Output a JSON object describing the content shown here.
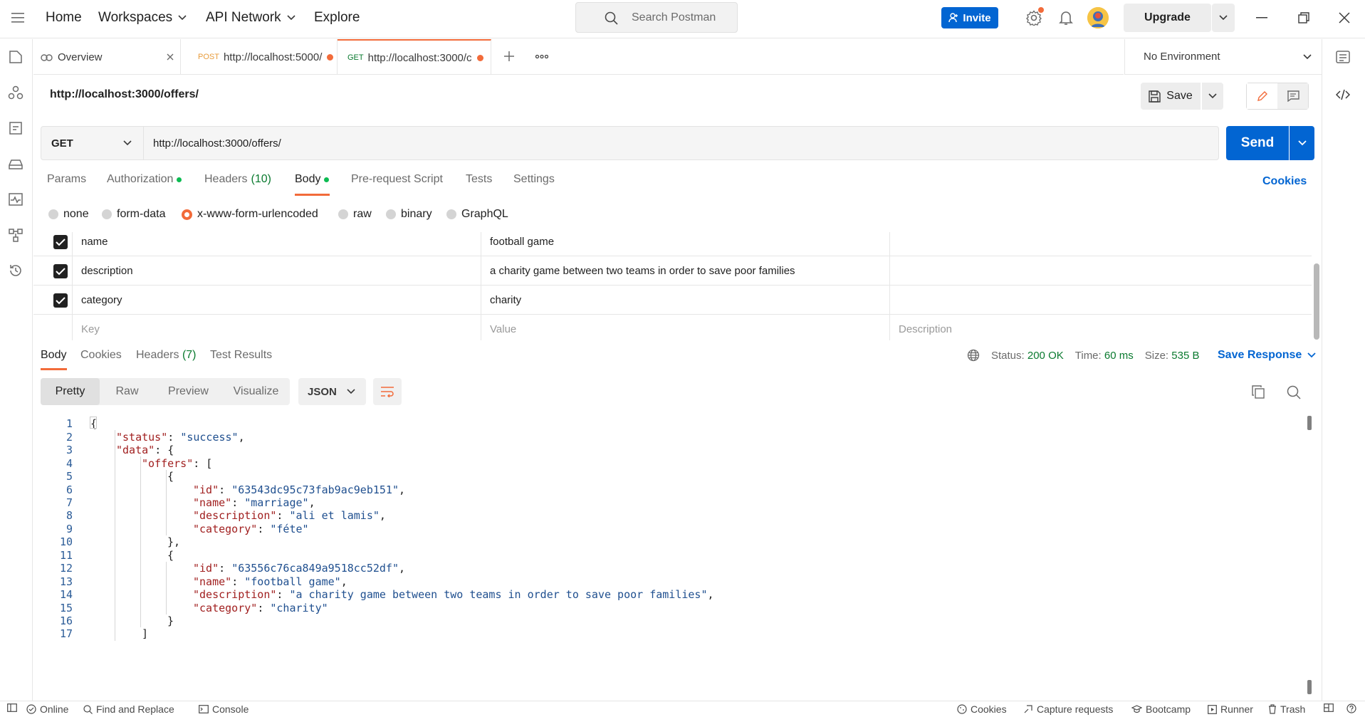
{
  "topbar": {
    "nav": [
      "Home",
      "Workspaces",
      "API Network",
      "Explore"
    ],
    "search_placeholder": "Search Postman",
    "invite_label": "Invite",
    "upgrade_label": "Upgrade"
  },
  "tabs": [
    {
      "label": "Overview",
      "method": ""
    },
    {
      "label": "http://localhost:5000/",
      "method": "POST"
    },
    {
      "label": "http://localhost:3000/c",
      "method": "GET"
    }
  ],
  "environment": "No Environment",
  "request": {
    "title": "http://localhost:3000/offers/",
    "save_label": "Save",
    "method": "GET",
    "url": "http://localhost:3000/offers/",
    "send_label": "Send"
  },
  "request_tabs": {
    "params": "Params",
    "authorization": "Authorization",
    "headers": "Headers",
    "headers_count": "(10)",
    "body": "Body",
    "prerequest": "Pre-request Script",
    "tests": "Tests",
    "settings": "Settings",
    "cookies": "Cookies"
  },
  "body_types": [
    "none",
    "form-data",
    "x-www-form-urlencoded",
    "raw",
    "binary",
    "GraphQL"
  ],
  "kv_rows": [
    {
      "key": "name",
      "value": "football game"
    },
    {
      "key": "description",
      "value": "a charity game between two teams in order to save poor families"
    },
    {
      "key": "category",
      "value": "charity"
    }
  ],
  "kv_placeholders": {
    "key": "Key",
    "value": "Value",
    "description": "Description"
  },
  "response": {
    "tabs": {
      "body": "Body",
      "cookies": "Cookies",
      "headers": "Headers",
      "headers_count": "(7)",
      "tests": "Test Results"
    },
    "status_label": "Status:",
    "status_value": "200 OK",
    "time_label": "Time:",
    "time_value": "60 ms",
    "size_label": "Size:",
    "size_value": "535 B",
    "save_response": "Save Response",
    "views": [
      "Pretty",
      "Raw",
      "Preview",
      "Visualize"
    ],
    "format": "JSON"
  },
  "code_lines": [
    {
      "n": "1",
      "indent": 0,
      "parts": [
        [
          "p",
          "{"
        ]
      ]
    },
    {
      "n": "2",
      "indent": 1,
      "parts": [
        [
          "k",
          "\"status\""
        ],
        [
          "p",
          ": "
        ],
        [
          "s",
          "\"success\""
        ],
        [
          "p",
          ","
        ]
      ]
    },
    {
      "n": "3",
      "indent": 1,
      "parts": [
        [
          "k",
          "\"data\""
        ],
        [
          "p",
          ": {"
        ]
      ]
    },
    {
      "n": "4",
      "indent": 2,
      "parts": [
        [
          "k",
          "\"offers\""
        ],
        [
          "p",
          ": ["
        ]
      ]
    },
    {
      "n": "5",
      "indent": 3,
      "parts": [
        [
          "p",
          "{"
        ]
      ]
    },
    {
      "n": "6",
      "indent": 4,
      "parts": [
        [
          "k",
          "\"id\""
        ],
        [
          "p",
          ": "
        ],
        [
          "s",
          "\"63543dc95c73fab9ac9eb151\""
        ],
        [
          "p",
          ","
        ]
      ]
    },
    {
      "n": "7",
      "indent": 4,
      "parts": [
        [
          "k",
          "\"name\""
        ],
        [
          "p",
          ": "
        ],
        [
          "s",
          "\"marriage\""
        ],
        [
          "p",
          ","
        ]
      ]
    },
    {
      "n": "8",
      "indent": 4,
      "parts": [
        [
          "k",
          "\"description\""
        ],
        [
          "p",
          ": "
        ],
        [
          "s",
          "\"ali et lamis\""
        ],
        [
          "p",
          ","
        ]
      ]
    },
    {
      "n": "9",
      "indent": 4,
      "parts": [
        [
          "k",
          "\"category\""
        ],
        [
          "p",
          ": "
        ],
        [
          "s",
          "\"féte\""
        ]
      ]
    },
    {
      "n": "10",
      "indent": 3,
      "parts": [
        [
          "p",
          "},"
        ]
      ]
    },
    {
      "n": "11",
      "indent": 3,
      "parts": [
        [
          "p",
          "{"
        ]
      ]
    },
    {
      "n": "12",
      "indent": 4,
      "parts": [
        [
          "k",
          "\"id\""
        ],
        [
          "p",
          ": "
        ],
        [
          "s",
          "\"63556c76ca849a9518cc52df\""
        ],
        [
          "p",
          ","
        ]
      ]
    },
    {
      "n": "13",
      "indent": 4,
      "parts": [
        [
          "k",
          "\"name\""
        ],
        [
          "p",
          ": "
        ],
        [
          "s",
          "\"football game\""
        ],
        [
          "p",
          ","
        ]
      ]
    },
    {
      "n": "14",
      "indent": 4,
      "parts": [
        [
          "k",
          "\"description\""
        ],
        [
          "p",
          ": "
        ],
        [
          "s",
          "\"a charity game between two teams in order to save poor families\""
        ],
        [
          "p",
          ","
        ]
      ]
    },
    {
      "n": "15",
      "indent": 4,
      "parts": [
        [
          "k",
          "\"category\""
        ],
        [
          "p",
          ": "
        ],
        [
          "s",
          "\"charity\""
        ]
      ]
    },
    {
      "n": "16",
      "indent": 3,
      "parts": [
        [
          "p",
          "}"
        ]
      ]
    },
    {
      "n": "17",
      "indent": 2,
      "parts": [
        [
          "p",
          "]"
        ]
      ]
    }
  ],
  "footer": {
    "online": "Online",
    "find_replace": "Find and Replace",
    "console": "Console",
    "cookies": "Cookies",
    "capture": "Capture requests",
    "bootcamp": "Bootcamp",
    "runner": "Runner",
    "trash": "Trash"
  },
  "colors": {
    "accent": "#0265d2",
    "orange": "#f26b3a",
    "status_green": "#0a7a2f"
  }
}
